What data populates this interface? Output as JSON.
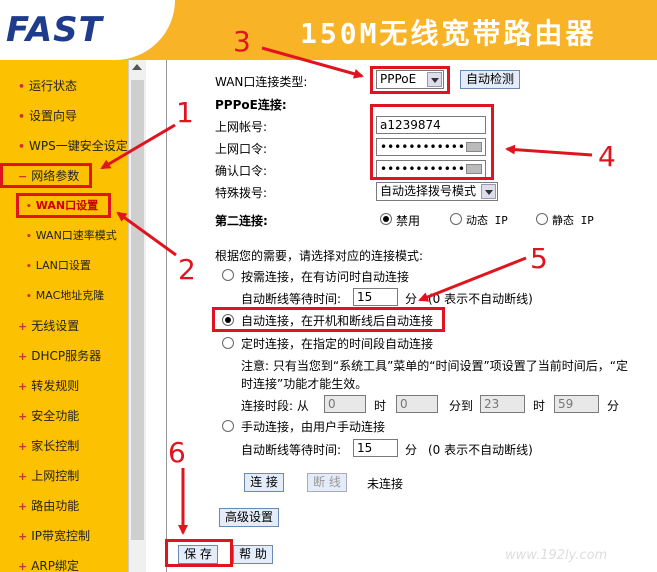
{
  "header": {
    "logo": "FAST",
    "title": "150M无线宽带路由器"
  },
  "sidebar": {
    "items": [
      {
        "label": "运行状态"
      },
      {
        "label": "设置向导"
      },
      {
        "label": "WPS一键安全设定"
      },
      {
        "label": "网络参数"
      },
      {
        "label": "WAN口设置"
      },
      {
        "label": "WAN口速率模式"
      },
      {
        "label": "LAN口设置"
      },
      {
        "label": "MAC地址克隆"
      },
      {
        "label": "无线设置"
      },
      {
        "label": "DHCP服务器"
      },
      {
        "label": "转发规则"
      },
      {
        "label": "安全功能"
      },
      {
        "label": "家长控制"
      },
      {
        "label": "上网控制"
      },
      {
        "label": "路由功能"
      },
      {
        "label": "IP带宽控制"
      },
      {
        "label": "ARP绑定"
      }
    ]
  },
  "wan": {
    "type_label": "WAN口连接类型:",
    "type_value": "PPPoE",
    "auto_detect": "自动检测",
    "pppoe_heading": "PPPoE连接:",
    "account_label": "上网帐号:",
    "account_value": "a1239874",
    "password_label": "上网口令:",
    "password_value": "••••••••••••••",
    "confirm_label": "确认口令:",
    "confirm_value": "••••••••••••••",
    "dial_label": "特殊拨号:",
    "dial_value": "自动选择拨号模式",
    "second_label": "第二连接:",
    "second_options": [
      "禁用",
      "动态 IP",
      "静态 IP"
    ]
  },
  "mode": {
    "heading": "根据您的需要，请选择对应的连接模式:",
    "on_demand": "按需连接，在有访问时自动连接",
    "idle_label_1": "自动断线等待时间:",
    "idle_value_1": "15",
    "idle_unit": "分",
    "idle_note": "(0 表示不自动断线)",
    "auto": "自动连接，在开机和断线后自动连接",
    "scheduled": "定时连接，在指定的时间段自动连接",
    "note_line1": "注意: 只有当您到“系统工具”菜单的“时间设置”项设置了当前时间后，“定",
    "note_line2": "时连接”功能才能生效。",
    "period_label": "连接时段: 从",
    "from_h": "0",
    "hour_unit": "时",
    "from_m": "0",
    "to_label": "分到",
    "to_h": "23",
    "to_m": "59",
    "min_unit": "分",
    "manual": "手动连接，由用户手动连接",
    "idle_label_2": "自动断线等待时间:",
    "idle_value_2": "15",
    "connect_btn": "连 接",
    "disconnect_btn": "断 线",
    "status": "未连接",
    "advanced_btn": "高级设置",
    "save_btn": "保 存",
    "help_btn": "帮 助"
  },
  "annotations": [
    "1",
    "2",
    "3",
    "4",
    "5",
    "6"
  ],
  "watermark": "www.192ly.com",
  "colors": {
    "accent": "#e0141e",
    "sidebar": "#fcc100",
    "header": "#f9b326",
    "logo": "#1f3c8c"
  }
}
